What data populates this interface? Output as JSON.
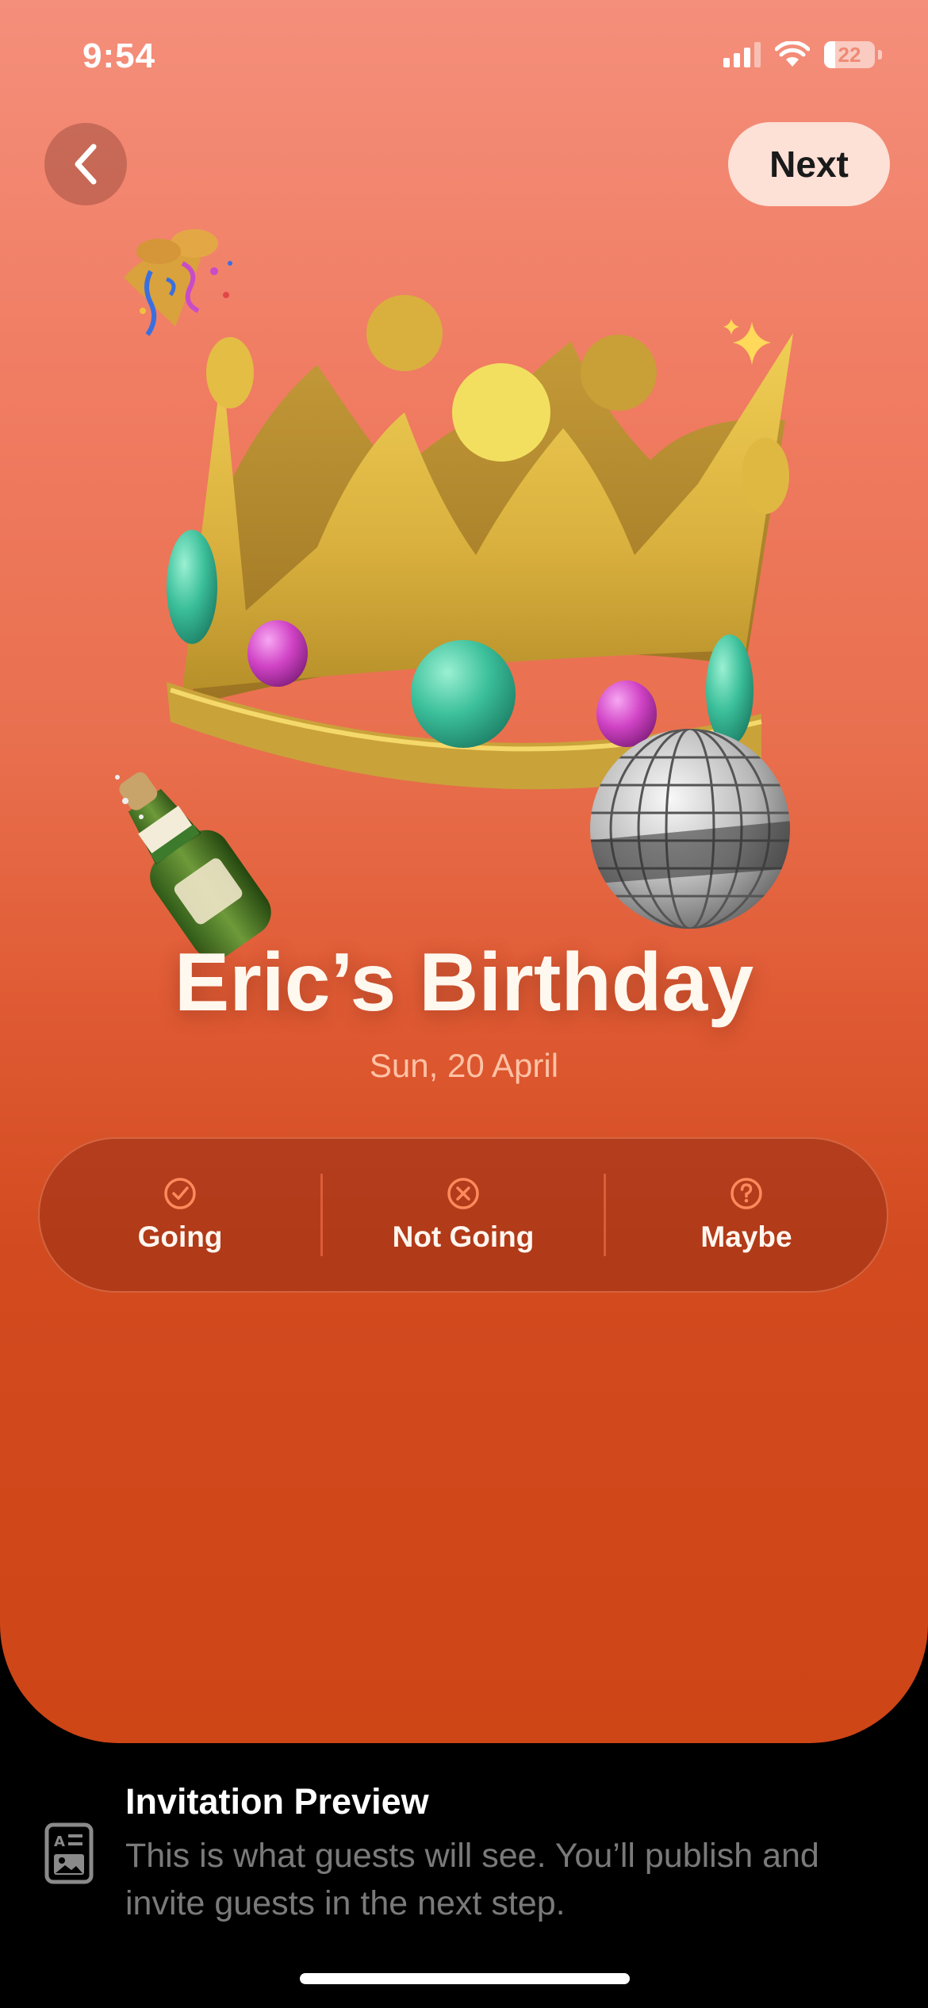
{
  "status_bar": {
    "time": "9:54",
    "battery": "22"
  },
  "header": {
    "back_icon": "chevron-left-icon",
    "next_label": "Next"
  },
  "event": {
    "title": "Eric’s Birthday",
    "date": "Sun, 20 April",
    "artwork": [
      "party-popper-icon",
      "sparkles-icon",
      "crown-icon",
      "champagne-bottle-icon",
      "disco-ball-icon"
    ]
  },
  "rsvp": {
    "options": [
      {
        "label": "Going",
        "icon": "checkmark-circle-icon"
      },
      {
        "label": "Not Going",
        "icon": "x-circle-icon"
      },
      {
        "label": "Maybe",
        "icon": "question-circle-icon"
      }
    ]
  },
  "info": {
    "icon": "invitation-card-icon",
    "title": "Invitation Preview",
    "body": "This is what guests will see. You’ll publish and invite guests in the next step."
  },
  "colors": {
    "card_top": "#f48f7b",
    "card_bottom": "#ce4516",
    "next_button_bg": "#fde0d6",
    "date_text": "#ffc2a6",
    "rsvp_icon": "#ff8a5c"
  }
}
